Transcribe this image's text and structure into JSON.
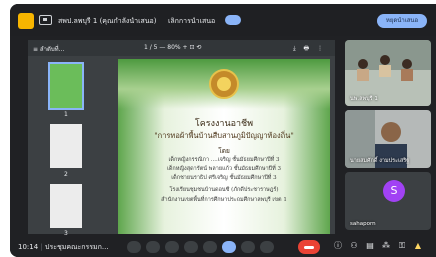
{
  "topbar": {
    "meeting_title": "สพป.ลพบุรี 1 (คุณกำลังนำเสนอ)",
    "presenting_text": "เลิกการนำเสนอ",
    "join_button": "หยุดนำเสนอ"
  },
  "pdf_toolbar": {
    "left_text": "≡  ลำดับที่...",
    "page_info": "1 / 5   —  80%  +   ⊡  ⟲",
    "right_icons": "⤓ 🖶 ⋮"
  },
  "thumbnails": [
    {
      "num": "1"
    },
    {
      "num": "2"
    },
    {
      "num": "3"
    }
  ],
  "slide": {
    "project_label": "โครงงานอาชีพ",
    "title": "\"การทอผ้าพื้นบ้านสืบสานภูมิปัญญาท้องถิ่น\"",
    "by": "โดย",
    "students": [
      "เด็กหญิงกรรณิกา  ....เจริญ  ชั้นมัธยมศึกษาปีที่ 3",
      "เด็กหญิงสุดารัตน์   พลายแก้ว    ชั้นมัธยมศึกษาปีที่ 3",
      "เด็กชายนราธิป  ศรีเจริญ     ชั้นมัธยมศึกษาปีที่ 3"
    ],
    "school": "โรงเรียนชุมชนบ้านดอนซี (ภักดีประชาราษฎร์)",
    "office": "สำนักงานเขตพื้นที่การศึกษาประถมศึกษาลพบุรี เขต 1"
  },
  "participants": [
    {
      "label": "นพ.ลพบุรี 1"
    },
    {
      "label": "นายสมศักดิ์ งามประเสริฐ"
    },
    {
      "label": "sahaporn",
      "initial": "S"
    }
  ],
  "bottombar": {
    "time": "10:14",
    "meeting_name": "ประชุมคณะกรรมก..."
  },
  "colors": {
    "accent": "#8ab4f8",
    "end_call": "#ea4335",
    "avatar": "#a142f4",
    "app_icon": "#f7b500"
  }
}
